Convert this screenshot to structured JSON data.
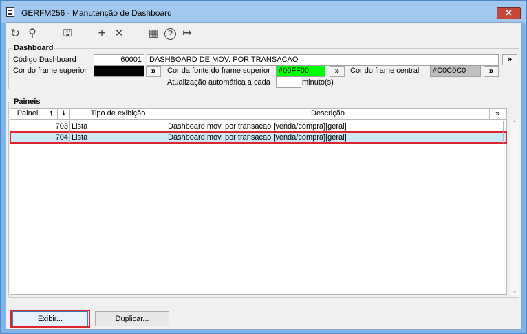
{
  "window": {
    "title": "GERFM256 - Manutenção de Dashboard",
    "close_glyph": "✕"
  },
  "toolbar": {
    "icons": [
      "refresh-icon",
      "search-icon",
      "save-icon",
      "add-icon",
      "delete-icon",
      "calendar-icon",
      "help-icon",
      "exit-icon"
    ],
    "glyphs": {
      "refresh": "↻",
      "search": "⚲",
      "save": "🖫",
      "add": "+",
      "delete": "✕",
      "calendar": "▦",
      "help": "?",
      "exit": "↦"
    }
  },
  "dashboard": {
    "group_title": "Dashboard",
    "codigo_label": "Código Dashboard",
    "codigo_value": "60001",
    "descricao_value": "DASHBOARD DE MOV. POR TRANSACAO",
    "more_button": "»",
    "cor_frame_superior_label": "Cor do frame superior",
    "cor_frame_superior_color": "#000000",
    "cor_fonte_label": "Cor da fonte do frame superior",
    "cor_fonte_value": "#00FF00",
    "cor_fonte_color": "#00ff00",
    "cor_frame_central_label": "Cor do frame central",
    "cor_frame_central_value": "#C0C0C0",
    "cor_frame_central_color": "#c0c0c0",
    "atualizacao_label": "Atualização automática a cada",
    "atualizacao_value": "",
    "minutos_label": "minuto(s)"
  },
  "paineis": {
    "group_title": "Paineis",
    "columns": {
      "painel": "Painel",
      "sort_up": "🠕",
      "sort_down": "🠗",
      "tipo": "Tipo de exibição",
      "descricao": "Descrição",
      "more": "»"
    },
    "rows": [
      {
        "painel": "703",
        "tipo": "Lista",
        "descricao": "Dashboard mov. por transacao [venda/compra][geral]"
      },
      {
        "painel": "704",
        "tipo": "Lista",
        "descricao": "Dashboard mov. por transacao [venda/compra][geral]"
      }
    ],
    "scroll_up": "⌃",
    "scroll_down": "⌄"
  },
  "buttons": {
    "exibir": "Exibir...",
    "duplicar": "Duplicar..."
  }
}
